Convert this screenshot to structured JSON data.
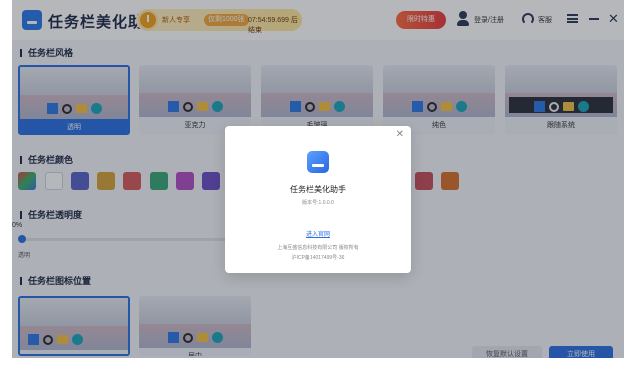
{
  "app": {
    "title": "任务栏美化助手"
  },
  "header": {
    "promo_text": "新人专享",
    "promo_badge": "仅剩1000张",
    "promo_timer": "07:54:59.699 后结束",
    "vip_label": "限时特惠",
    "login_label": "登录/注册",
    "help_label": "客服"
  },
  "sections": {
    "style": "任务栏风格",
    "color": "任务栏颜色",
    "opacity": "任务栏透明度",
    "position": "任务栏图标位置"
  },
  "styles": [
    {
      "label": "透明",
      "selected": true
    },
    {
      "label": "亚克力",
      "selected": false
    },
    {
      "label": "毛玻璃",
      "selected": false
    },
    {
      "label": "纯色",
      "selected": false
    },
    {
      "label": "跟随系统",
      "selected": false
    }
  ],
  "colors": [
    "#6a5bd8",
    "#ffffff",
    "#5763c9",
    "#d4a23a",
    "#d45a5a",
    "#3aa779",
    "#b34fc4",
    "#6a4fc4",
    "#c44f5a",
    "#d4702a"
  ],
  "opacity": {
    "value": "0%",
    "label": "透明",
    "level": 0
  },
  "positions": [
    {
      "label": "居左",
      "selected": true
    },
    {
      "label": "居中",
      "selected": false
    }
  ],
  "buttons": {
    "secondary": "恢复默认设置",
    "primary": "立即使用"
  },
  "dialog": {
    "title": "任务栏美化助手",
    "version": "版本号:1.0.0.0",
    "link": "进入官网",
    "copyright": "上海互盛信息科技有限公司 版权所有",
    "icp": "沪ICP备14017499号-36"
  }
}
